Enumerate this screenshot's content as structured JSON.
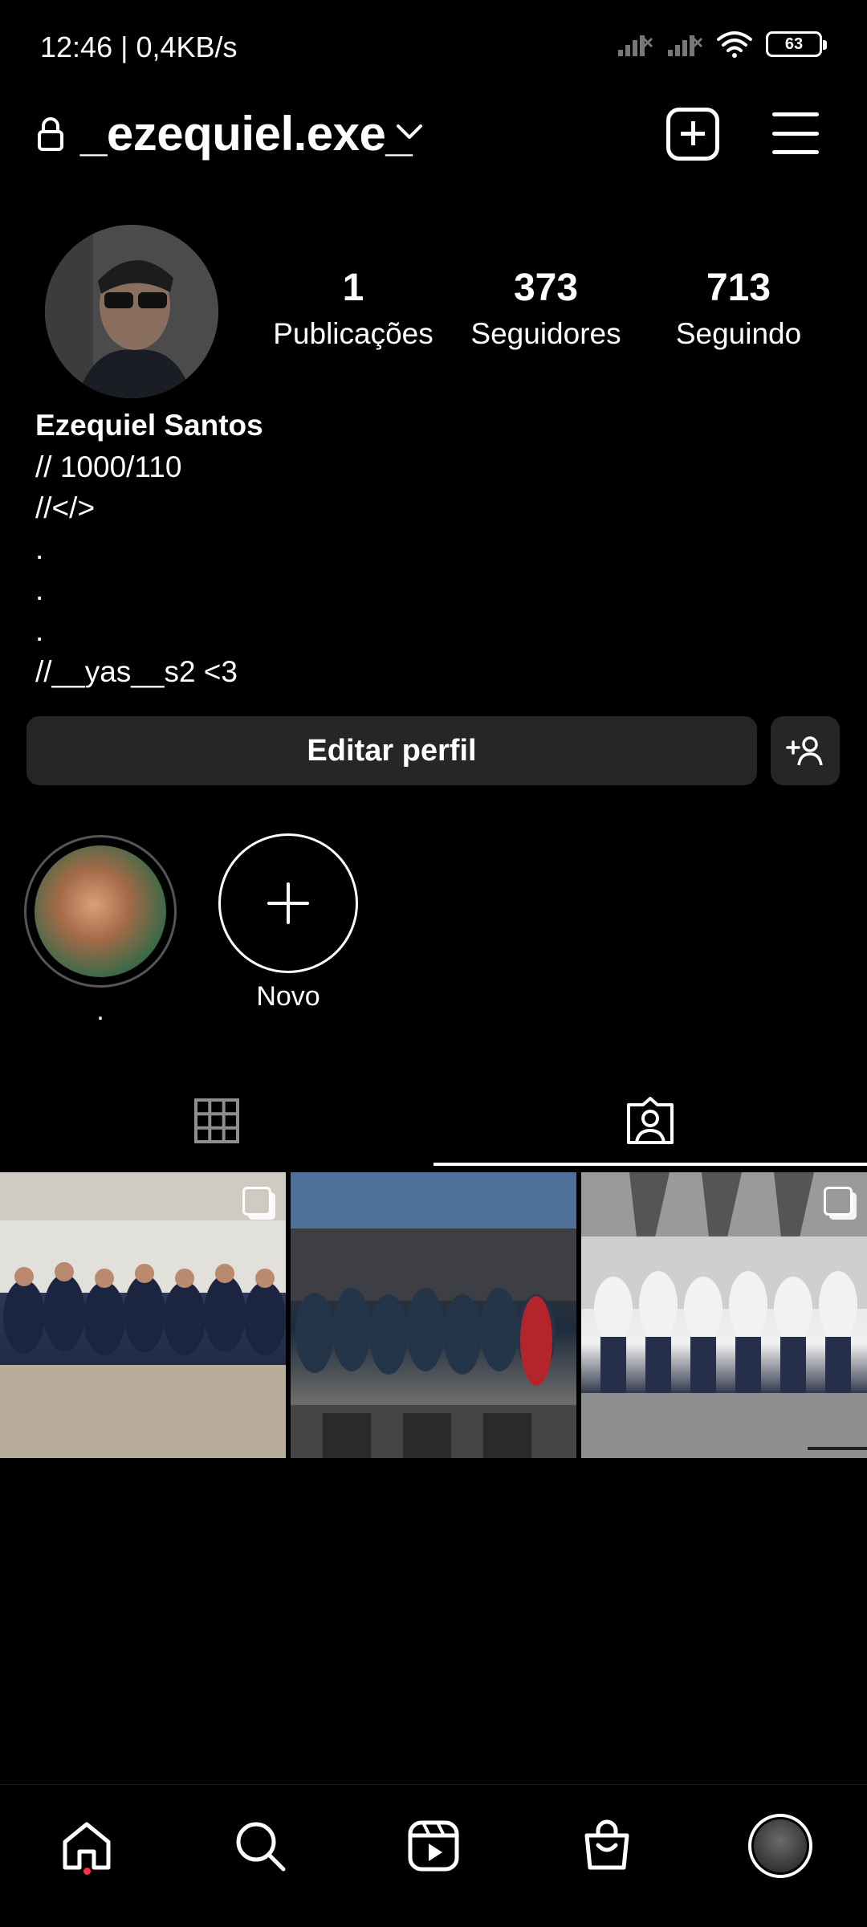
{
  "status_bar": {
    "time_speed": "12:46 | 0,4KB/s",
    "battery": "63"
  },
  "header": {
    "username": "_ezequiel.exe_"
  },
  "profile": {
    "stats": [
      {
        "value": "1",
        "label": "Publicações"
      },
      {
        "value": "373",
        "label": "Seguidores"
      },
      {
        "value": "713",
        "label": "Seguindo"
      }
    ],
    "name": "Ezequiel Santos",
    "bio_lines": [
      "// 1000/110",
      "//</>",
      ".",
      ".",
      ".",
      "//__yas__s2 <3"
    ]
  },
  "actions": {
    "edit_profile_label": "Editar perfil"
  },
  "highlights": [
    {
      "label": "."
    },
    {
      "label": "Novo"
    }
  ],
  "tabs": {
    "active": "tagged"
  },
  "colors": {
    "background": "#000000",
    "button_bg": "#262626",
    "notification_dot": "#ff3040"
  },
  "icons": [
    "lock-icon",
    "chevron-down-icon",
    "new-post-icon",
    "menu-icon",
    "add-person-icon",
    "plus-icon",
    "grid-icon",
    "tagged-icon",
    "home-icon",
    "search-icon",
    "reels-icon",
    "shop-icon"
  ]
}
